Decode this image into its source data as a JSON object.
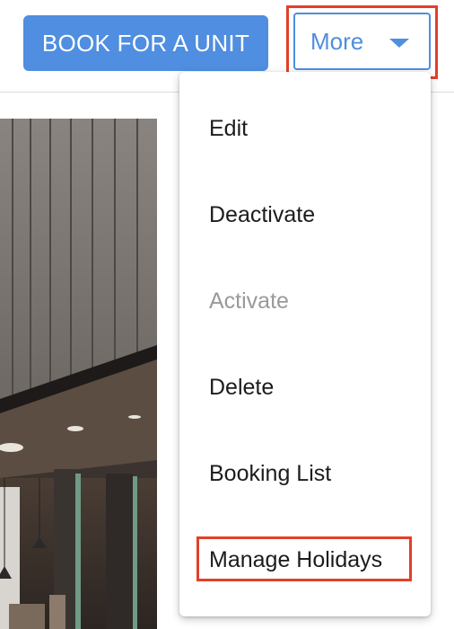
{
  "toolbar": {
    "book_label": "BOOK FOR A UNIT",
    "more_label": "More"
  },
  "menu": {
    "items": [
      {
        "label": "Edit",
        "enabled": true
      },
      {
        "label": "Deactivate",
        "enabled": true
      },
      {
        "label": "Activate",
        "enabled": false
      },
      {
        "label": "Delete",
        "enabled": true
      },
      {
        "label": "Booking List",
        "enabled": true
      },
      {
        "label": "Manage Holidays",
        "enabled": true,
        "highlighted": true
      }
    ]
  },
  "colors": {
    "primary": "#4f8ee0",
    "highlight": "#e2402a",
    "disabled_text": "#9a9a9a"
  },
  "icons": {
    "more_caret": "caret-down-icon"
  }
}
